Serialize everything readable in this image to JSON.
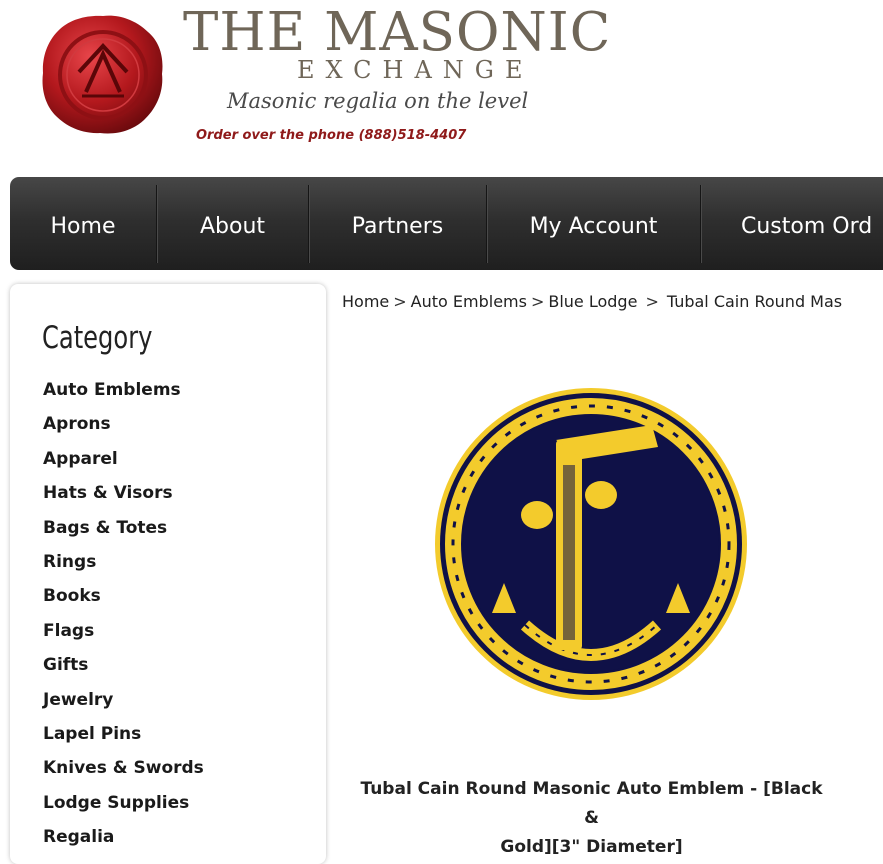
{
  "header": {
    "logo_title": "THE MASONIC",
    "logo_subtitle": "EXCHANGE",
    "tagline": "Masonic regalia on the level",
    "phone_text": "Order over the phone (888)518-4407",
    "seal_color": "#b3181d"
  },
  "nav": {
    "items": [
      {
        "label": "Home"
      },
      {
        "label": "About"
      },
      {
        "label": "Partners"
      },
      {
        "label": "My Account"
      },
      {
        "label": "Custom Ord"
      }
    ]
  },
  "sidebar": {
    "heading": "Category",
    "items": [
      {
        "label": "Auto Emblems"
      },
      {
        "label": "Aprons"
      },
      {
        "label": "Apparel"
      },
      {
        "label": "Hats & Visors"
      },
      {
        "label": "Bags & Totes"
      },
      {
        "label": "Rings"
      },
      {
        "label": "Books"
      },
      {
        "label": "Flags"
      },
      {
        "label": "Gifts"
      },
      {
        "label": "Jewelry"
      },
      {
        "label": "Lapel Pins"
      },
      {
        "label": "Knives & Swords"
      },
      {
        "label": "Lodge Supplies"
      },
      {
        "label": "Regalia"
      }
    ]
  },
  "breadcrumb": {
    "items": [
      "Home",
      "Auto Emblems",
      "Blue Lodge",
      "Tubal Cain Round Mas"
    ],
    "separator": ">"
  },
  "product": {
    "title_line1": "Tubal Cain Round Masonic Auto Emblem - [Black &",
    "title_line2": "Gold][3\" Diameter]",
    "colors": {
      "field": "#0f1147",
      "gold": "#f3cb2c"
    }
  }
}
